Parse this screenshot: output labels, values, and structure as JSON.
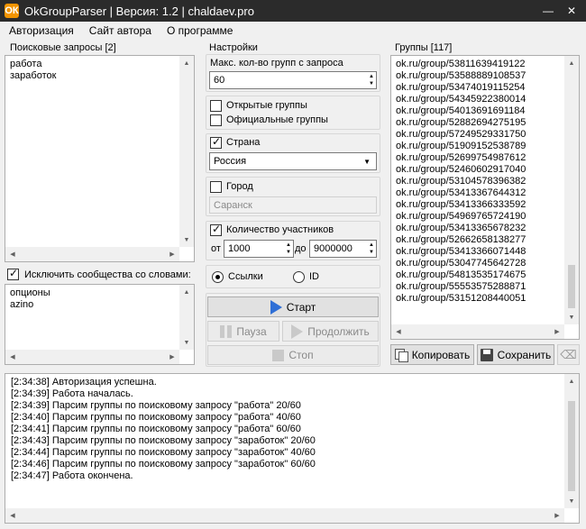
{
  "window": {
    "title": "OkGroupParser | Версия: 1.2 | chaldaev.pro",
    "icon_glyph": "ОК",
    "minimize_glyph": "—",
    "close_glyph": "✕"
  },
  "menu": [
    {
      "label": "Авторизация"
    },
    {
      "label": "Сайт автора"
    },
    {
      "label": "О программе"
    }
  ],
  "queries": {
    "label": "Поисковые запросы [2]",
    "items": [
      "работа",
      "заработок"
    ]
  },
  "exclude": {
    "label": "Исключить сообщества со словами:",
    "checked": true,
    "items": [
      "опционы",
      "azino"
    ]
  },
  "settings": {
    "label": "Настройки",
    "max_groups_label": "Макс. кол-во групп с запроса",
    "max_groups_value": "60",
    "open_groups_label": "Открытые группы",
    "open_groups_checked": false,
    "official_groups_label": "Официальные группы",
    "official_groups_checked": false,
    "country_label": "Страна",
    "country_checked": true,
    "country_value": "Россия",
    "city_label": "Город",
    "city_checked": false,
    "city_placeholder": "Саранск",
    "members_label": "Количество участников",
    "members_checked": true,
    "from_label": "от",
    "from_value": "1000",
    "to_label": "до",
    "to_value": "9000000",
    "links_label": "Ссылки",
    "links_selected": true,
    "id_label": "ID",
    "id_selected": false,
    "start_label": "Старт",
    "pause_label": "Пауза",
    "continue_label": "Продолжить",
    "stop_label": "Стоп"
  },
  "groups": {
    "label": "Группы [117]",
    "items": [
      "ok.ru/group/53811639419122",
      "ok.ru/group/53588889108537",
      "ok.ru/group/53474019115254",
      "ok.ru/group/54345922380014",
      "ok.ru/group/54013691691184",
      "ok.ru/group/52882694275195",
      "ok.ru/group/57249529331750",
      "ok.ru/group/51909152538789",
      "ok.ru/group/52699754987612",
      "ok.ru/group/52460602917040",
      "ok.ru/group/53104578396382",
      "ok.ru/group/53413367644312",
      "ok.ru/group/53413366333592",
      "ok.ru/group/54969765724190",
      "ok.ru/group/53413365678232",
      "ok.ru/group/52662658138277",
      "ok.ru/group/53413366071448",
      "ok.ru/group/53047745642728",
      "ok.ru/group/54813535174675",
      "ok.ru/group/55553575288871",
      "ok.ru/group/53151208440051"
    ],
    "copy_label": "Копировать",
    "save_label": "Сохранить"
  },
  "log": {
    "lines": [
      "[2:34:38] Авторизация успешна.",
      "[2:34:39] Работа началась.",
      "[2:34:39] Парсим группы по поисковому запросу \"работа\" 20/60",
      "[2:34:40] Парсим группы по поисковому запросу \"работа\" 40/60",
      "[2:34:41] Парсим группы по поисковому запросу \"работа\" 60/60",
      "[2:34:43] Парсим группы по поисковому запросу \"заработок\" 20/60",
      "[2:34:44] Парсим группы по поисковому запросу \"заработок\" 40/60",
      "[2:34:46] Парсим группы по поисковому запросу \"заработок\" 60/60",
      "[2:34:47] Работа окончена."
    ]
  }
}
